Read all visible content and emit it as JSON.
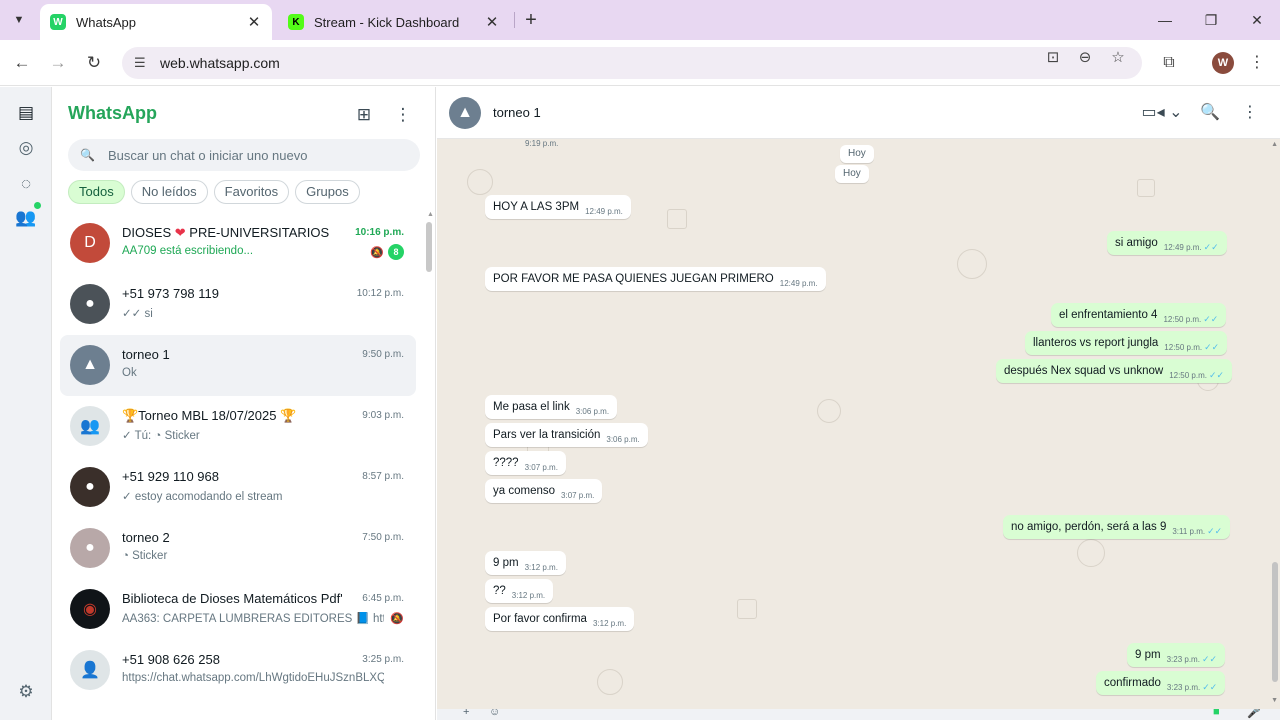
{
  "browser": {
    "tabs": [
      {
        "title": "WhatsApp",
        "favicon_color": "#25d366",
        "favicon": "W",
        "active": true
      },
      {
        "title": "Stream - Kick Dashboard",
        "favicon_color": "#53fc18",
        "favicon": "K",
        "active": false
      }
    ],
    "url": "web.whatsapp.com",
    "profile_initial": "W"
  },
  "sidebar": {
    "brand": "WhatsApp",
    "search_placeholder": "Buscar un chat o iniciar uno nuevo",
    "filters": [
      "Todos",
      "No leídos",
      "Favoritos",
      "Grupos"
    ],
    "active_filter": "Todos"
  },
  "chats": [
    {
      "name": "DIOSES",
      "name_suffix": " PRE-UNIVERSITARIOS",
      "heart": "❤",
      "preview": "AA709 está escribiendo...",
      "time": "10:16 p.m.",
      "unread": "8",
      "muted": true,
      "typing": true,
      "avatar_color": "#c24a3a",
      "avatar": "D"
    },
    {
      "name": "+51 973 798 119",
      "preview": "✓✓ si",
      "time": "10:12 p.m.",
      "avatar_color": "#4b5258",
      "avatar": "●"
    },
    {
      "name": "torneo 1",
      "preview": "Ok",
      "time": "9:50 p.m.",
      "selected": true,
      "avatar_color": "#6d7f90",
      "avatar": "▲"
    },
    {
      "name": "🏆Torneo MBL 18/07/2025 🏆",
      "preview": "✓ Tú: ◔ Sticker",
      "time": "9:03 p.m.",
      "avatar_color": "#dfe5e7",
      "avatar": "👥"
    },
    {
      "name": "+51 929 110 968",
      "preview": "✓ estoy acomodando el stream",
      "time": "8:57 p.m.",
      "avatar_color": "#3a2f2a",
      "avatar": "●"
    },
    {
      "name": "torneo 2",
      "preview": "◔ Sticker",
      "time": "7:50 p.m.",
      "avatar_color": "#b8a8a8",
      "avatar": "●"
    },
    {
      "name": "Biblioteca de Dioses Matemáticos Pdf's",
      "preview": "AA363: CARPETA LUMBRERAS EDITORES 📘 https:/...",
      "time": "6:45 p.m.",
      "muted": true,
      "avatar_color": "#101418",
      "avatar": "◉"
    },
    {
      "name": "+51 908 626 258",
      "preview": "https://chat.whatsapp.com/LhWgtidoEHuJSznBLXQTQX",
      "time": "3:25 p.m.",
      "avatar_color": "#dfe5e7",
      "avatar": "👤"
    }
  ],
  "conversation": {
    "title": "torneo 1",
    "day_labels": [
      "Hoy",
      "Hoy"
    ],
    "top_time": "9:19 p.m.",
    "messages": [
      {
        "text": "HOY  A LAS 3PM",
        "time": "12:49 p.m.",
        "dir": "in"
      },
      {
        "text": "si amigo",
        "time": "12:49 p.m.",
        "dir": "out"
      },
      {
        "text": "POR FAVOR ME PASA QUIENES JUEGAN PRIMERO",
        "time": "12:49 p.m.",
        "dir": "in"
      },
      {
        "text": "el enfrentamiento 4",
        "time": "12:50 p.m.",
        "dir": "out"
      },
      {
        "text": "llanteros vs report jungla",
        "time": "12:50 p.m.",
        "dir": "out"
      },
      {
        "text": "después Nex squad vs unknow",
        "time": "12:50 p.m.",
        "dir": "out"
      },
      {
        "text": "Me pasa el link",
        "time": "3:06 p.m.",
        "dir": "in"
      },
      {
        "text": "Pars ver la transición",
        "time": "3:06 p.m.",
        "dir": "in"
      },
      {
        "text": "????",
        "time": "3:07 p.m.",
        "dir": "in"
      },
      {
        "text": "ya comenso",
        "time": "3:07 p.m.",
        "dir": "in"
      },
      {
        "text": "no amigo, perdón, será a las 9",
        "time": "3:11 p.m.",
        "dir": "out"
      },
      {
        "text": "9 pm",
        "time": "3:12 p.m.",
        "dir": "in"
      },
      {
        "text": "??",
        "time": "3:12 p.m.",
        "dir": "in"
      },
      {
        "text": "Por favor confirma",
        "time": "3:12 p.m.",
        "dir": "in"
      },
      {
        "text": "9 pm",
        "time": "3:23 p.m.",
        "dir": "out"
      },
      {
        "text": "confirmado",
        "time": "3:23 p.m.",
        "dir": "out"
      }
    ]
  },
  "colors": {
    "brand_green": "#25a55a",
    "outgoing_bubble": "#d9fdd3",
    "chat_background": "#efeae2",
    "read_ticks": "#53bdeb"
  }
}
